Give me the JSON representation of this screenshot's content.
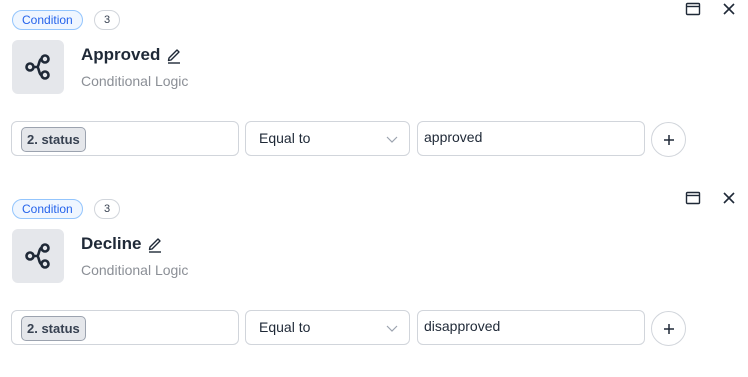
{
  "conditions": [
    {
      "badge": "Condition",
      "count": "3",
      "title": "Approved",
      "subtitle": "Conditional Logic",
      "variable": "2. status",
      "operator": "Equal to",
      "value": "approved"
    },
    {
      "badge": "Condition",
      "count": "3",
      "title": "Decline",
      "subtitle": "Conditional Logic",
      "variable": "2. status",
      "operator": "Equal to",
      "value": "disapproved"
    }
  ],
  "icons": {
    "window": "window-icon",
    "close": "close-icon",
    "app": "branch-icon",
    "edit": "pencil-icon",
    "chevron": "chevron-down-icon",
    "add": "plus-icon"
  },
  "colors": {
    "badge_border": "#93c5fd",
    "badge_text": "#2563eb",
    "icon_dark": "#1f2937"
  }
}
